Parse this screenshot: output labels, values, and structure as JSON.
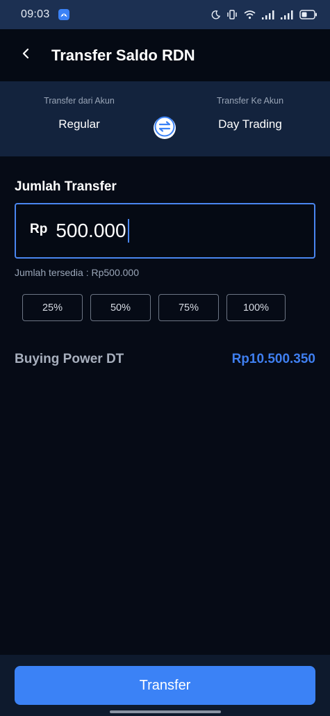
{
  "status_bar": {
    "time": "09:03",
    "icons": [
      "app-notification-icon",
      "moon-icon",
      "vibrate-icon",
      "wifi-icon",
      "signal-icon",
      "signal-icon",
      "battery-icon"
    ]
  },
  "header": {
    "title": "Transfer Saldo RDN",
    "back_icon": "chevron-left-icon"
  },
  "accounts": {
    "from_label": "Transfer dari Akun",
    "from_value": "Regular",
    "to_label": "Transfer Ke Akun",
    "to_value": "Day Trading",
    "swap_icon": "swap-arrows-icon"
  },
  "transfer": {
    "section_label": "Jumlah Transfer",
    "currency_prefix": "Rp",
    "amount": "500.000",
    "available_text": "Jumlah tersedia : Rp500.000",
    "percent_options": [
      "25%",
      "50%",
      "75%",
      "100%"
    ]
  },
  "buying_power": {
    "label": "Buying Power DT",
    "value": "Rp10.500.350"
  },
  "footer": {
    "button_label": "Transfer"
  },
  "colors": {
    "accent": "#3b82f6",
    "background": "#060b16",
    "panel": "#13233d",
    "status_bar": "#1c3052"
  }
}
